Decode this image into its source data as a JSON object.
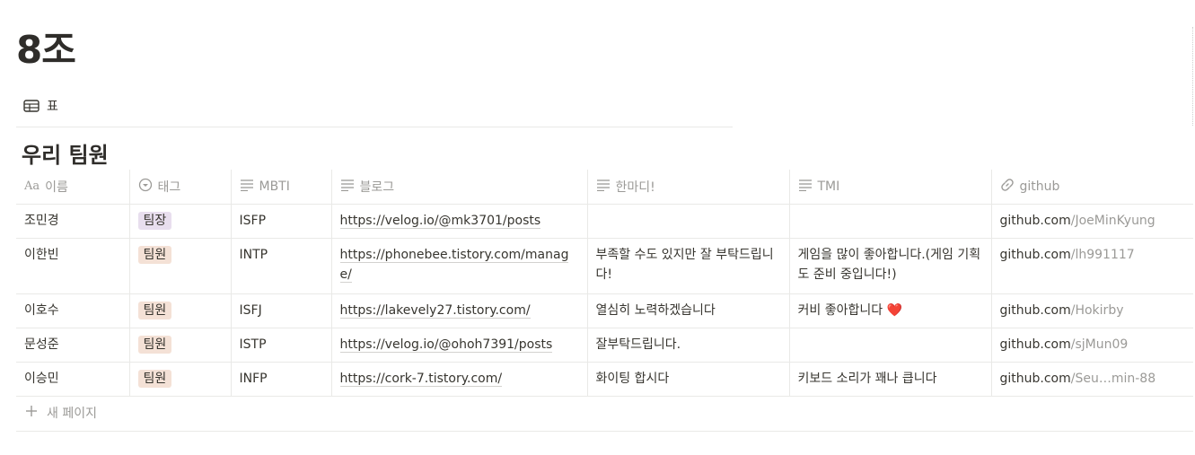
{
  "page": {
    "title": "8조"
  },
  "view": {
    "label": "표"
  },
  "database": {
    "title": "우리 팀원",
    "columns": [
      {
        "key": "name",
        "label": "이름",
        "icon": "text-aa-icon"
      },
      {
        "key": "tag",
        "label": "태그",
        "icon": "select-icon"
      },
      {
        "key": "mbti",
        "label": "MBTI",
        "icon": "text-lines-icon"
      },
      {
        "key": "blog",
        "label": "블로그",
        "icon": "text-lines-icon"
      },
      {
        "key": "comment",
        "label": "한마디!",
        "icon": "text-lines-icon"
      },
      {
        "key": "tmi",
        "label": "TMI",
        "icon": "text-lines-icon"
      },
      {
        "key": "github",
        "label": "github",
        "icon": "link-icon"
      }
    ],
    "rows": [
      {
        "name": "조민경",
        "tag": "팀장",
        "tag_color": "#e8deee",
        "mbti": "ISFP",
        "blog": "https://velog.io/@mk3701/posts",
        "comment": "",
        "tmi": "",
        "github_host": "github.com",
        "github_user": "/JoeMinKyung"
      },
      {
        "name": "이한빈",
        "tag": "팀원",
        "tag_color": "#f4e1d6",
        "mbti": "INTP",
        "blog": "https://phonebee.tistory.com/manage/",
        "comment": "부족할 수도 있지만 잘 부탁드립니다!",
        "tmi": "게임을 많이 좋아합니다.(게임 기획도 준비 중입니다!)",
        "github_host": "github.com",
        "github_user": "/lh991117"
      },
      {
        "name": "이호수",
        "tag": "팀원",
        "tag_color": "#f4e1d6",
        "mbti": "ISFJ",
        "blog": "https://lakevely27.tistory.com/",
        "comment": "열심히 노력하겠습니다",
        "tmi": "커비 좋아합니다",
        "tmi_emoji": "❤️",
        "github_host": "github.com",
        "github_user": "/Hokirby"
      },
      {
        "name": "문성준",
        "tag": "팀원",
        "tag_color": "#f4e1d6",
        "mbti": "ISTP",
        "blog": "https://velog.io/@ohoh7391/posts",
        "comment": "잘부탁드립니다.",
        "tmi": "",
        "github_host": "github.com",
        "github_user": "/sjMun09"
      },
      {
        "name": "이승민",
        "tag": "팀원",
        "tag_color": "#f4e1d6",
        "mbti": "INFP",
        "blog": "https://cork-7.tistory.com/",
        "comment": "화이팅 합시다",
        "tmi": "키보드 소리가 꽤나 큽니다",
        "github_host": "github.com",
        "github_user": "/Seu…min-88"
      }
    ],
    "new_page_label": "새 페이지"
  }
}
